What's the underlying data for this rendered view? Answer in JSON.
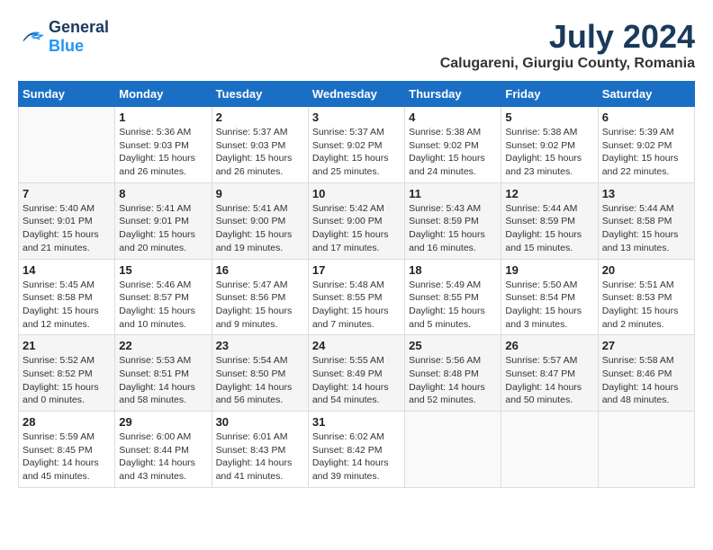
{
  "header": {
    "logo_line1": "General",
    "logo_line2": "Blue",
    "month_year": "July 2024",
    "location": "Calugareni, Giurgiu County, Romania"
  },
  "days_of_week": [
    "Sunday",
    "Monday",
    "Tuesday",
    "Wednesday",
    "Thursday",
    "Friday",
    "Saturday"
  ],
  "weeks": [
    [
      {
        "day": "",
        "info": ""
      },
      {
        "day": "1",
        "info": "Sunrise: 5:36 AM\nSunset: 9:03 PM\nDaylight: 15 hours\nand 26 minutes."
      },
      {
        "day": "2",
        "info": "Sunrise: 5:37 AM\nSunset: 9:03 PM\nDaylight: 15 hours\nand 26 minutes."
      },
      {
        "day": "3",
        "info": "Sunrise: 5:37 AM\nSunset: 9:02 PM\nDaylight: 15 hours\nand 25 minutes."
      },
      {
        "day": "4",
        "info": "Sunrise: 5:38 AM\nSunset: 9:02 PM\nDaylight: 15 hours\nand 24 minutes."
      },
      {
        "day": "5",
        "info": "Sunrise: 5:38 AM\nSunset: 9:02 PM\nDaylight: 15 hours\nand 23 minutes."
      },
      {
        "day": "6",
        "info": "Sunrise: 5:39 AM\nSunset: 9:02 PM\nDaylight: 15 hours\nand 22 minutes."
      }
    ],
    [
      {
        "day": "7",
        "info": "Sunrise: 5:40 AM\nSunset: 9:01 PM\nDaylight: 15 hours\nand 21 minutes."
      },
      {
        "day": "8",
        "info": "Sunrise: 5:41 AM\nSunset: 9:01 PM\nDaylight: 15 hours\nand 20 minutes."
      },
      {
        "day": "9",
        "info": "Sunrise: 5:41 AM\nSunset: 9:00 PM\nDaylight: 15 hours\nand 19 minutes."
      },
      {
        "day": "10",
        "info": "Sunrise: 5:42 AM\nSunset: 9:00 PM\nDaylight: 15 hours\nand 17 minutes."
      },
      {
        "day": "11",
        "info": "Sunrise: 5:43 AM\nSunset: 8:59 PM\nDaylight: 15 hours\nand 16 minutes."
      },
      {
        "day": "12",
        "info": "Sunrise: 5:44 AM\nSunset: 8:59 PM\nDaylight: 15 hours\nand 15 minutes."
      },
      {
        "day": "13",
        "info": "Sunrise: 5:44 AM\nSunset: 8:58 PM\nDaylight: 15 hours\nand 13 minutes."
      }
    ],
    [
      {
        "day": "14",
        "info": "Sunrise: 5:45 AM\nSunset: 8:58 PM\nDaylight: 15 hours\nand 12 minutes."
      },
      {
        "day": "15",
        "info": "Sunrise: 5:46 AM\nSunset: 8:57 PM\nDaylight: 15 hours\nand 10 minutes."
      },
      {
        "day": "16",
        "info": "Sunrise: 5:47 AM\nSunset: 8:56 PM\nDaylight: 15 hours\nand 9 minutes."
      },
      {
        "day": "17",
        "info": "Sunrise: 5:48 AM\nSunset: 8:55 PM\nDaylight: 15 hours\nand 7 minutes."
      },
      {
        "day": "18",
        "info": "Sunrise: 5:49 AM\nSunset: 8:55 PM\nDaylight: 15 hours\nand 5 minutes."
      },
      {
        "day": "19",
        "info": "Sunrise: 5:50 AM\nSunset: 8:54 PM\nDaylight: 15 hours\nand 3 minutes."
      },
      {
        "day": "20",
        "info": "Sunrise: 5:51 AM\nSunset: 8:53 PM\nDaylight: 15 hours\nand 2 minutes."
      }
    ],
    [
      {
        "day": "21",
        "info": "Sunrise: 5:52 AM\nSunset: 8:52 PM\nDaylight: 15 hours\nand 0 minutes."
      },
      {
        "day": "22",
        "info": "Sunrise: 5:53 AM\nSunset: 8:51 PM\nDaylight: 14 hours\nand 58 minutes."
      },
      {
        "day": "23",
        "info": "Sunrise: 5:54 AM\nSunset: 8:50 PM\nDaylight: 14 hours\nand 56 minutes."
      },
      {
        "day": "24",
        "info": "Sunrise: 5:55 AM\nSunset: 8:49 PM\nDaylight: 14 hours\nand 54 minutes."
      },
      {
        "day": "25",
        "info": "Sunrise: 5:56 AM\nSunset: 8:48 PM\nDaylight: 14 hours\nand 52 minutes."
      },
      {
        "day": "26",
        "info": "Sunrise: 5:57 AM\nSunset: 8:47 PM\nDaylight: 14 hours\nand 50 minutes."
      },
      {
        "day": "27",
        "info": "Sunrise: 5:58 AM\nSunset: 8:46 PM\nDaylight: 14 hours\nand 48 minutes."
      }
    ],
    [
      {
        "day": "28",
        "info": "Sunrise: 5:59 AM\nSunset: 8:45 PM\nDaylight: 14 hours\nand 45 minutes."
      },
      {
        "day": "29",
        "info": "Sunrise: 6:00 AM\nSunset: 8:44 PM\nDaylight: 14 hours\nand 43 minutes."
      },
      {
        "day": "30",
        "info": "Sunrise: 6:01 AM\nSunset: 8:43 PM\nDaylight: 14 hours\nand 41 minutes."
      },
      {
        "day": "31",
        "info": "Sunrise: 6:02 AM\nSunset: 8:42 PM\nDaylight: 14 hours\nand 39 minutes."
      },
      {
        "day": "",
        "info": ""
      },
      {
        "day": "",
        "info": ""
      },
      {
        "day": "",
        "info": ""
      }
    ]
  ]
}
